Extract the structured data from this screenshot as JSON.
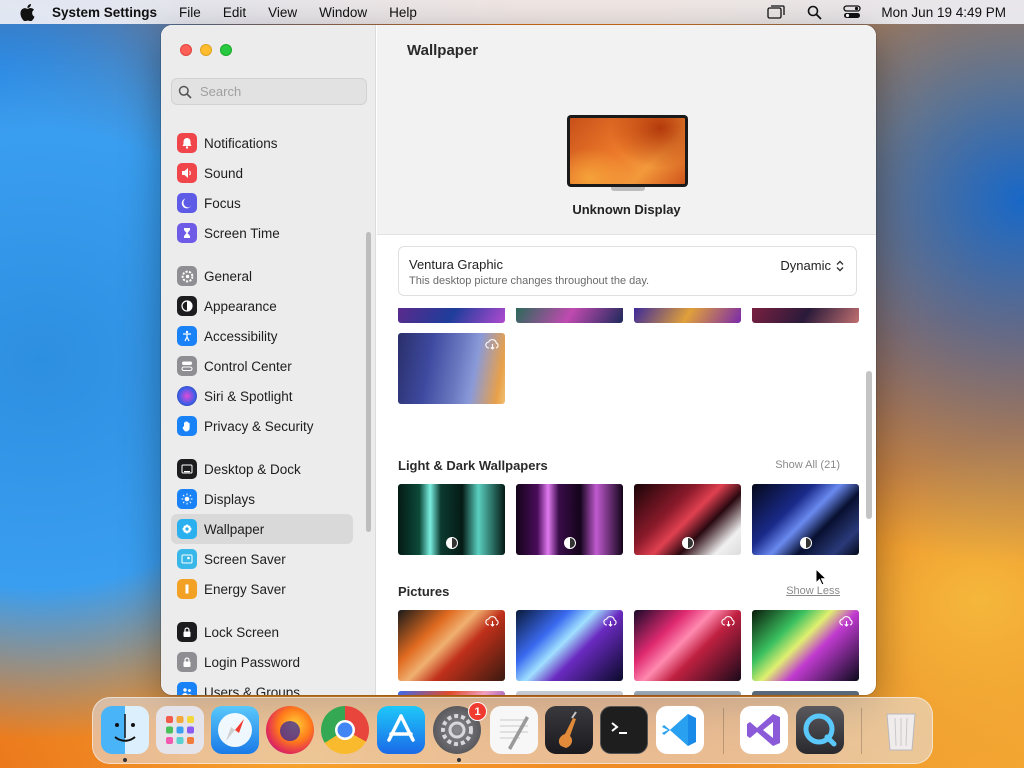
{
  "menubar": {
    "app_name": "System Settings",
    "menus": [
      "File",
      "Edit",
      "View",
      "Window",
      "Help"
    ],
    "clock": "Mon Jun 19  4:49 PM"
  },
  "window": {
    "search_placeholder": "Search"
  },
  "sidebar": {
    "items": [
      {
        "label": "Notifications",
        "icon": "bell-icon",
        "color": "#f0454a"
      },
      {
        "label": "Sound",
        "icon": "speaker-icon",
        "color": "#f0454a"
      },
      {
        "label": "Focus",
        "icon": "moon-icon",
        "color": "#5e5ce6"
      },
      {
        "label": "Screen Time",
        "icon": "hourglass-icon",
        "color": "#6e5ce6"
      },
      {
        "label": "General",
        "icon": "gear-icon",
        "color": "#8e8e93"
      },
      {
        "label": "Appearance",
        "icon": "appearance-icon",
        "color": "#1c1c1e"
      },
      {
        "label": "Accessibility",
        "icon": "accessibility-icon",
        "color": "#1a82f7"
      },
      {
        "label": "Control Center",
        "icon": "control-center-icon",
        "color": "#8e8e93"
      },
      {
        "label": "Siri & Spotlight",
        "icon": "siri-icon",
        "color": "#2c2c54"
      },
      {
        "label": "Privacy & Security",
        "icon": "hand-icon",
        "color": "#1a82f7"
      },
      {
        "label": "Desktop & Dock",
        "icon": "desktop-dock-icon",
        "color": "#1c1c1e"
      },
      {
        "label": "Displays",
        "icon": "sun-icon",
        "color": "#1a82f7"
      },
      {
        "label": "Wallpaper",
        "icon": "wallpaper-icon",
        "color": "#2ab0ee"
      },
      {
        "label": "Screen Saver",
        "icon": "screen-saver-icon",
        "color": "#38b7e8"
      },
      {
        "label": "Energy Saver",
        "icon": "battery-icon",
        "color": "#f2a125"
      },
      {
        "label": "Lock Screen",
        "icon": "lock-icon",
        "color": "#1c1c1e"
      },
      {
        "label": "Login Password",
        "icon": "lock-icon",
        "color": "#8e8e93"
      },
      {
        "label": "Users & Groups",
        "icon": "users-icon",
        "color": "#1a82f7"
      }
    ],
    "active": "Wallpaper"
  },
  "main": {
    "title": "Wallpaper",
    "display_name": "Unknown Display",
    "current_wallpaper": {
      "name": "Ventura Graphic",
      "description": "This desktop picture changes throughout the day.",
      "mode": "Dynamic"
    },
    "sections": [
      {
        "title": "Light & Dark Wallpapers",
        "link": "Show All (21)"
      },
      {
        "title": "Pictures",
        "link": "Show Less"
      }
    ]
  },
  "dock": {
    "apps": [
      "Finder",
      "Launchpad",
      "Safari",
      "Firefox",
      "Chrome",
      "App Store",
      "System Settings",
      "TextEdit",
      "Instruments",
      "Terminal",
      "Visual Studio Code",
      "Visual Studio",
      "QuickTime Player",
      "Trash"
    ],
    "system_settings_badge": "1"
  }
}
